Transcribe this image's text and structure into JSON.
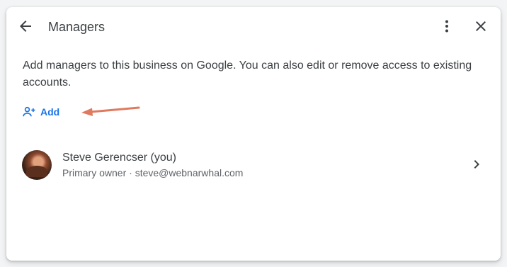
{
  "dialog": {
    "title": "Managers",
    "description": "Add managers to this business on Google. You can also edit or remove access to existing accounts.",
    "add_label": "Add"
  },
  "managers": [
    {
      "name": "Steve Gerencser (you)",
      "role": "Primary owner",
      "separator": "·",
      "email": "steve@webnarwhal.com"
    }
  ],
  "colors": {
    "accent": "#1a73e8",
    "annotation_arrow": "#e07a5f",
    "text_primary": "#3c4043",
    "text_secondary": "#5f6368"
  },
  "icons": {
    "back": "arrow-back-icon",
    "more": "more-vert-icon",
    "close": "close-icon",
    "add": "person-add-icon",
    "row_action": "chevron-right-icon"
  }
}
